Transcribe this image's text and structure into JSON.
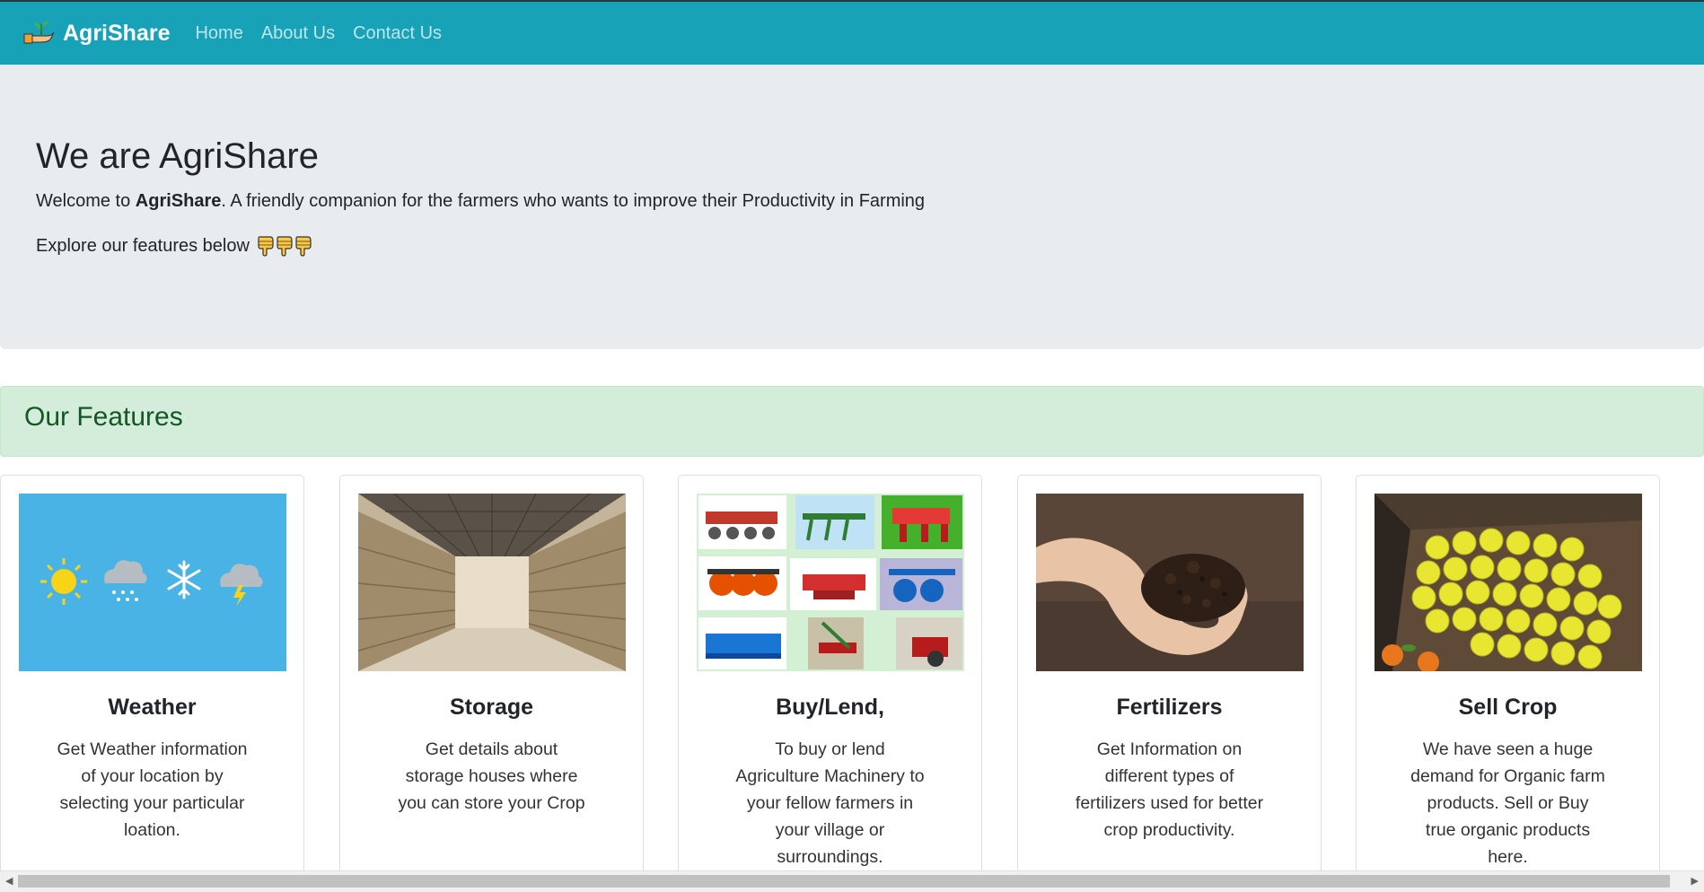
{
  "navbar": {
    "brand": "AgriShare",
    "links": [
      "Home",
      "About Us",
      "Contact Us"
    ]
  },
  "jumbotron": {
    "title": "We are AgriShare",
    "lead_prefix": "Welcome to ",
    "lead_brand": "AgriShare",
    "lead_suffix": ". A friendly companion for the farmers who wants to improve their Productivity in Farming",
    "explore": "Explore our features below"
  },
  "features": {
    "heading": "Our Features"
  },
  "cards": [
    {
      "title": "Weather",
      "text": "Get Weather information of your location by selecting your particular loation."
    },
    {
      "title": "Storage",
      "text": "Get details about storage houses where you can store your Crop"
    },
    {
      "title": "Buy/Lend,",
      "text": "To buy or lend Agriculture Machinery to your fellow farmers in your village or surroundings."
    },
    {
      "title": "Fertilizers",
      "text": "Get Information on different types of fertilizers used for better crop productivity."
    },
    {
      "title": "Sell Crop",
      "text": "We have seen a huge demand for Organic farm products. Sell or Buy true organic products here."
    }
  ],
  "icons": {
    "logo": "farmer-hand-plant-icon",
    "explore": "pointing-down-hand-icon"
  },
  "colors": {
    "navbar": "#17a2b8",
    "jumbotron": "#e9ecef",
    "features_bg": "#d4edda",
    "features_text": "#155724"
  }
}
